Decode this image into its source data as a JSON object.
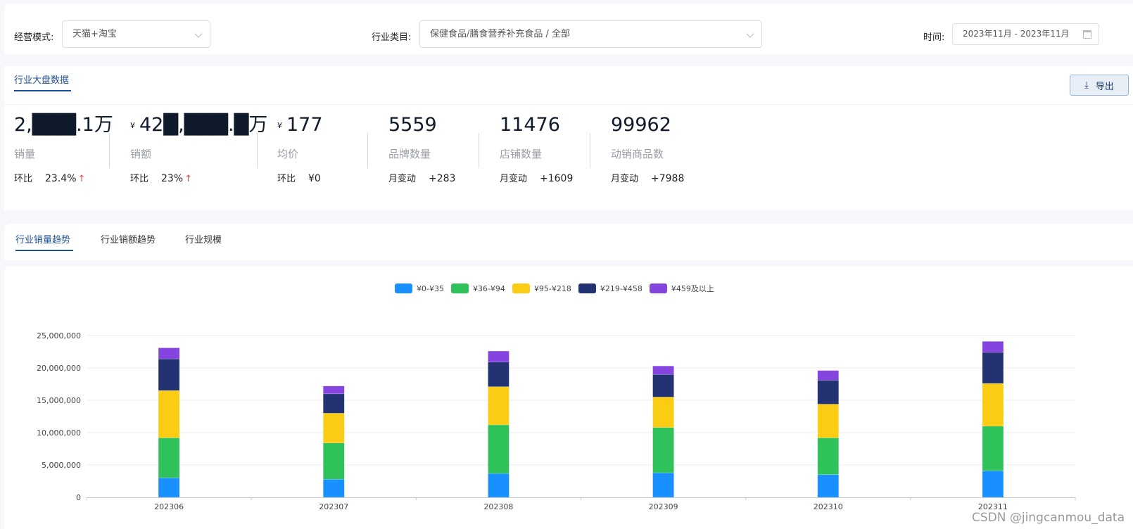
{
  "filters": {
    "mode_label": "经营模式:",
    "mode_value": "天猫+淘宝",
    "category_label": "行业类目:",
    "category_value": "保健食品/膳食营养补充食品 / 全部",
    "time_label": "时间:",
    "time_value": "2023年11月 - 2023年11月"
  },
  "overview": {
    "tab_label": "行业大盘数据",
    "export_label": "导出",
    "metrics": [
      {
        "value": "2,███.1万",
        "currency": "",
        "name": "销量",
        "change_label": "环比",
        "change_value": "23.4%",
        "trend": "↑"
      },
      {
        "value": "42█,███.█万",
        "currency": "¥",
        "name": "销额",
        "change_label": "环比",
        "change_value": "23%",
        "trend": "↑"
      },
      {
        "value": "177",
        "currency": "¥",
        "name": "均价",
        "change_label": "环比",
        "change_value": "¥0",
        "trend": ""
      },
      {
        "value": "5559",
        "currency": "",
        "name": "品牌数量",
        "change_label": "月变动",
        "change_value": "+283",
        "trend": ""
      },
      {
        "value": "11476",
        "currency": "",
        "name": "店铺数量",
        "change_label": "月变动",
        "change_value": "+1609",
        "trend": ""
      },
      {
        "value": "99962",
        "currency": "",
        "name": "动销商品数",
        "change_label": "月变动",
        "change_value": "+7988",
        "trend": ""
      }
    ]
  },
  "chart_tabs": [
    {
      "label": "行业销量趋势",
      "active": true
    },
    {
      "label": "行业销额趋势",
      "active": false
    },
    {
      "label": "行业规模",
      "active": false
    }
  ],
  "watermark": "CSDN @jingcanmou_data",
  "chart_data": {
    "type": "bar",
    "stacked": true,
    "title": "",
    "xlabel": "",
    "ylabel": "",
    "categories": [
      "202306",
      "202307",
      "202308",
      "202309",
      "202310",
      "202311"
    ],
    "ylim": [
      0,
      25000000
    ],
    "yticks": [
      "0",
      "5,000,000",
      "10,000,000",
      "15,000,000",
      "20,000,000",
      "25,000,000"
    ],
    "grid": true,
    "legend_position": "top-center",
    "series": [
      {
        "name": "¥0-¥35",
        "color": "#1890ff",
        "values": [
          3000000,
          2800000,
          3700000,
          3800000,
          3500000,
          4100000
        ]
      },
      {
        "name": "¥36-¥94",
        "color": "#2fc25b",
        "values": [
          6200000,
          5600000,
          7500000,
          7000000,
          5700000,
          6900000
        ]
      },
      {
        "name": "¥95-¥218",
        "color": "#facc14",
        "values": [
          7300000,
          4600000,
          5900000,
          4700000,
          5200000,
          6600000
        ]
      },
      {
        "name": "¥219-¥458",
        "color": "#223273",
        "values": [
          4900000,
          3000000,
          3800000,
          3500000,
          3700000,
          4800000
        ]
      },
      {
        "name": "¥459及以上",
        "color": "#8543e0",
        "values": [
          1700000,
          1200000,
          1700000,
          1300000,
          1500000,
          1700000
        ]
      }
    ]
  }
}
